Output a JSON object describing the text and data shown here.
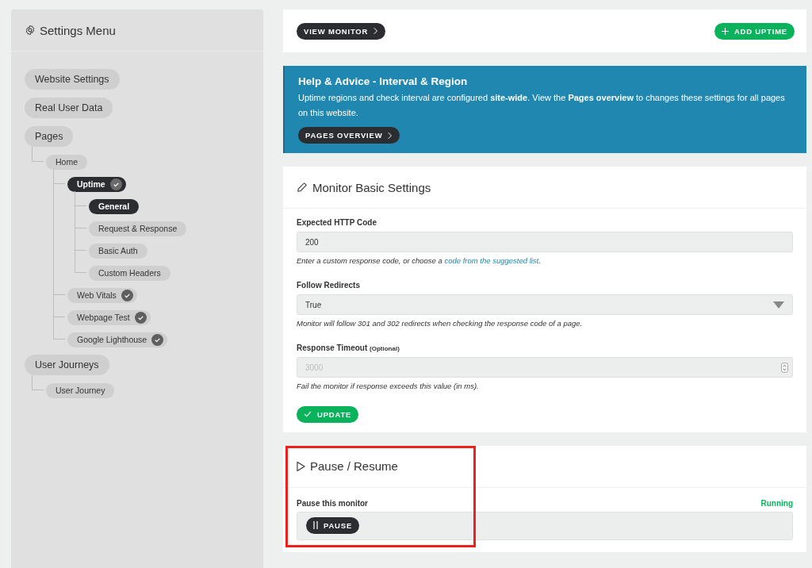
{
  "sidebar": {
    "title": "Settings Menu",
    "items": [
      {
        "label": "Website Settings",
        "selected": false,
        "checked": false
      },
      {
        "label": "Real User Data",
        "selected": false,
        "checked": false
      },
      {
        "label": "Pages",
        "selected": false,
        "checked": false,
        "children": [
          {
            "label": "Home",
            "selected": false,
            "checked": false,
            "children": [
              {
                "label": "Uptime",
                "selected": true,
                "checked": true,
                "children": [
                  {
                    "label": "General",
                    "selected": true,
                    "checked": false
                  },
                  {
                    "label": "Request & Response",
                    "selected": false,
                    "checked": false
                  },
                  {
                    "label": "Basic Auth",
                    "selected": false,
                    "checked": false
                  },
                  {
                    "label": "Custom Headers",
                    "selected": false,
                    "checked": false
                  }
                ]
              },
              {
                "label": "Web Vitals",
                "selected": false,
                "checked": true
              },
              {
                "label": "Webpage Test",
                "selected": false,
                "checked": true
              },
              {
                "label": "Google Lighthouse",
                "selected": false,
                "checked": true
              }
            ]
          }
        ]
      },
      {
        "label": "User Journeys",
        "selected": false,
        "checked": false,
        "children": [
          {
            "label": "User Journey",
            "selected": false,
            "checked": false
          }
        ]
      }
    ]
  },
  "toolbar": {
    "view_button": "VIEW MONITOR",
    "add_button": "ADD UPTIME"
  },
  "help": {
    "title": "Help & Advice - Interval & Region",
    "text": "Uptime regions and check interval are configured **site-wide**. View the **Pages overview** to changes these settings for all pages on this website.",
    "button": "PAGES OVERVIEW"
  },
  "basic_settings": {
    "title": "Monitor Basic Settings",
    "http_code": {
      "label": "Expected HTTP Code",
      "value": "200",
      "hint": "Enter a custom response code, or choose a ",
      "hint_link": "code from the suggested list",
      "hint_end": "."
    },
    "redirects": {
      "label": "Follow Redirects",
      "value": "True",
      "hint": "Monitor will follow 301 and 302 redirects when checking the response code of a page."
    },
    "timeout": {
      "label": "Response Timeout",
      "label_note": "(Optional)",
      "placeholder": "3000",
      "hint": "Fail the monitor if response exceeds this value (in ms)."
    },
    "update_button": "UPDATE"
  },
  "pause": {
    "title": "Pause / Resume",
    "label": "Pause this monitor",
    "status": "Running",
    "button": "PAUSE",
    "highlighted": true
  }
}
